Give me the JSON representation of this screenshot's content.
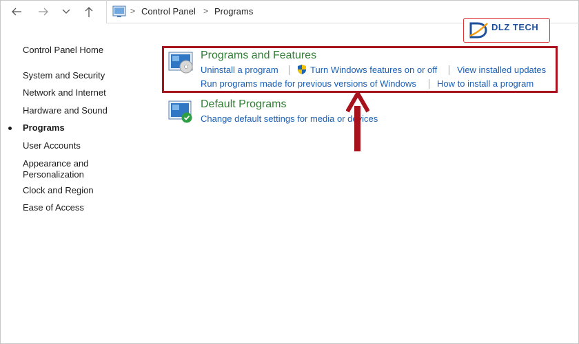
{
  "navigation": {
    "back": "back",
    "forward": "forward",
    "recent": "recent-locations",
    "up": "up"
  },
  "breadcrumb": {
    "items": [
      "Control Panel",
      "Programs"
    ]
  },
  "logo": {
    "text": "DLZ TECH"
  },
  "sidebar": {
    "items": [
      {
        "label": "Control Panel Home"
      },
      {
        "label": "System and Security"
      },
      {
        "label": "Network and Internet"
      },
      {
        "label": "Hardware and Sound"
      },
      {
        "label": "Programs",
        "active": true
      },
      {
        "label": "User Accounts"
      },
      {
        "label": "Appearance and Personalization"
      },
      {
        "label": "Clock and Region"
      },
      {
        "label": "Ease of Access"
      }
    ],
    "appearance_line1": "Appearance and",
    "appearance_line2": "Personalization"
  },
  "main": {
    "programs_and_features": {
      "title": "Programs and Features",
      "links": [
        "Uninstall a program",
        "Turn Windows features on or off",
        "View installed updates",
        "Run programs made for previous versions of Windows",
        "How to install a program"
      ]
    },
    "default_programs": {
      "title": "Default Programs",
      "links": [
        "Change default settings for media or devices"
      ]
    }
  },
  "colors": {
    "link": "#1a5fb4",
    "category_title": "#2e7d32",
    "highlight": "#a8121d",
    "logo_blue": "#1d4f9b"
  },
  "icons": {
    "programs_and_features": "programs-features-icon",
    "default_programs": "default-programs-icon",
    "shield": "uac-shield-icon",
    "arrow": "up-arrow-annotation"
  }
}
